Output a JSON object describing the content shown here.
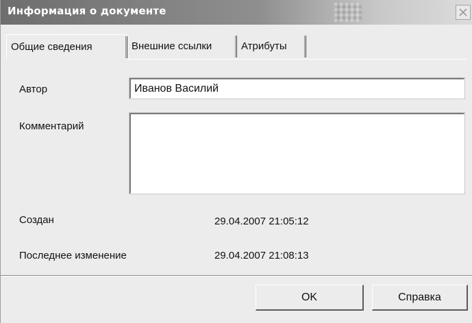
{
  "window": {
    "title": "Информация о документе",
    "close_icon": "close-icon"
  },
  "tabs": [
    {
      "label": "Общие сведения",
      "active": true
    },
    {
      "label": "Внешние ссылки",
      "active": false
    },
    {
      "label": "Атрибуты",
      "active": false
    }
  ],
  "form": {
    "author_label": "Автор",
    "author_value": "Иванов Василий",
    "comment_label": "Комментарий",
    "comment_value": "",
    "created_label": "Создан",
    "created_value": "29.04.2007  21:05:12",
    "modified_label": "Последнее изменение",
    "modified_value": "29.04.2007  21:08:13"
  },
  "buttons": {
    "ok_label": "OK",
    "help_label": "Справка"
  },
  "colors": {
    "dialog_background": "#ececec",
    "title_bar_start": "#6e6e6e",
    "title_bar_end": "#dcdcdc",
    "title_text": "#ffffff"
  }
}
